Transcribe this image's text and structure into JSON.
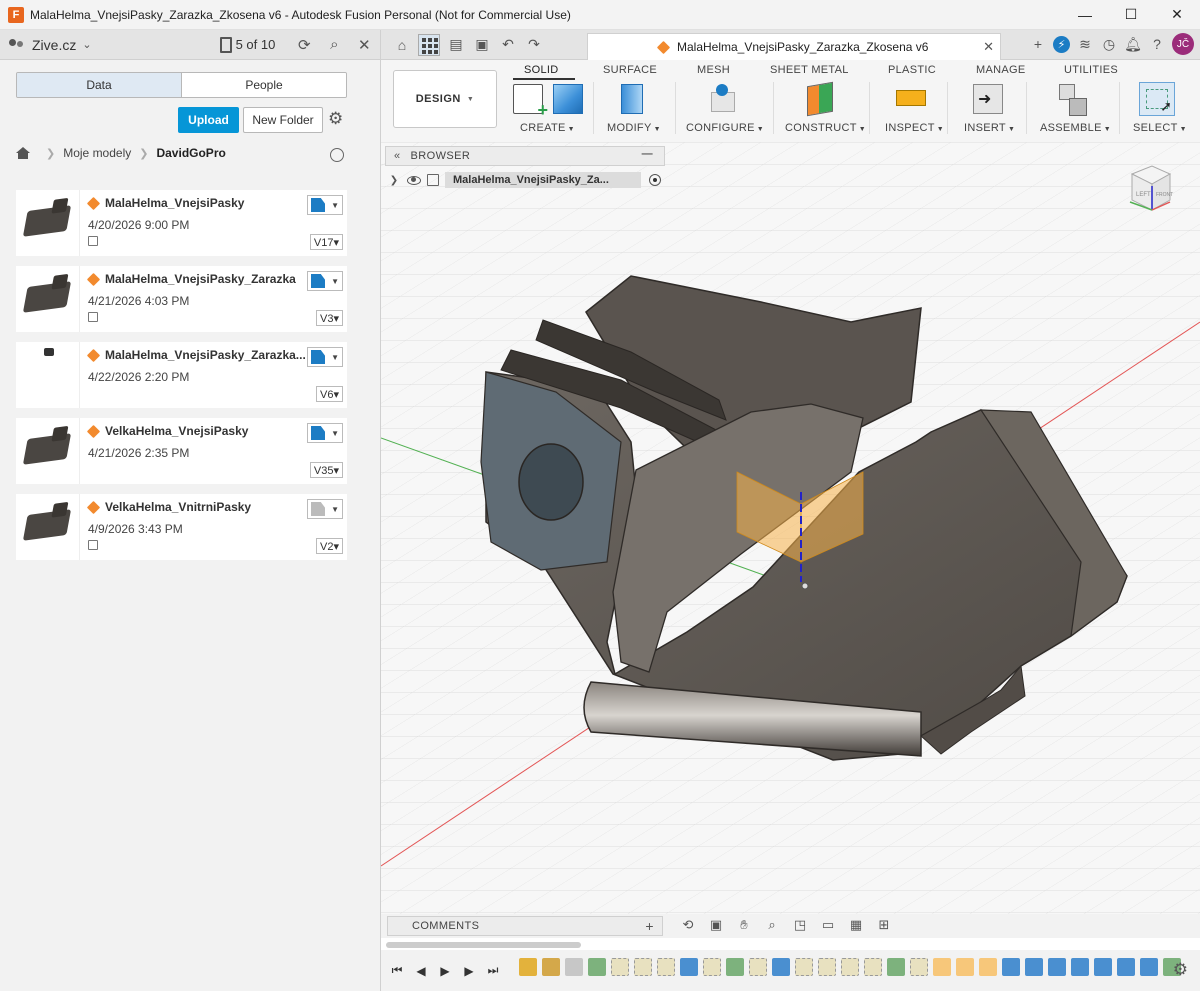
{
  "window": {
    "title": "MalaHelma_VnejsiPasky_Zarazka_Zkosena v6 - Autodesk Fusion Personal (Not for Commercial Use)",
    "logo_letter": "F",
    "minimize": "—",
    "maximize": "☐",
    "close": "✕"
  },
  "left": {
    "team": "Zive.cz",
    "job_status": "5 of 10",
    "tabs": [
      "Data",
      "People"
    ],
    "upload": "Upload",
    "new_folder": "New Folder",
    "breadcrumb": [
      "Moje modely",
      "DavidGoPro"
    ],
    "files": [
      {
        "name": "MalaHelma_VnejsiPasky",
        "date": "4/20/2026 9:00 PM",
        "version": "V17▾"
      },
      {
        "name": "MalaHelma_VnejsiPasky_Zarazka",
        "date": "4/21/2026 4:03 PM",
        "version": "V3▾"
      },
      {
        "name": "MalaHelma_VnejsiPasky_Zarazka...",
        "date": "4/22/2026 2:20 PM",
        "version": "V6▾"
      },
      {
        "name": "VelkaHelma_VnejsiPasky",
        "date": "4/21/2026 2:35 PM",
        "version": "V35▾"
      },
      {
        "name": "VelkaHelma_VnitrniPasky",
        "date": "4/9/2026 3:43 PM",
        "version": "V2▾"
      }
    ]
  },
  "tabbar": {
    "doc_title": "MalaHelma_VnejsiPasky_Zarazka_Zkosena v6",
    "avatar": "JČ"
  },
  "toolbar": {
    "workspace": "DESIGN",
    "tabs": [
      "SOLID",
      "SURFACE",
      "MESH",
      "SHEET METAL",
      "PLASTIC",
      "MANAGE",
      "UTILITIES"
    ],
    "groups": [
      "CREATE",
      "MODIFY",
      "CONFIGURE",
      "CONSTRUCT",
      "INSPECT",
      "INSERT",
      "ASSEMBLE",
      "SELECT"
    ]
  },
  "browser": {
    "header": "BROWSER",
    "root_item": "MalaHelma_VnejsiPasky_Za..."
  },
  "viewcube": {
    "left": "LEFT",
    "front": "FRONT"
  },
  "comments": {
    "label": "COMMENTS"
  },
  "colors": {
    "accent": "#0696d7",
    "brand_orange": "#f28a2e",
    "model": "#5e5852"
  }
}
